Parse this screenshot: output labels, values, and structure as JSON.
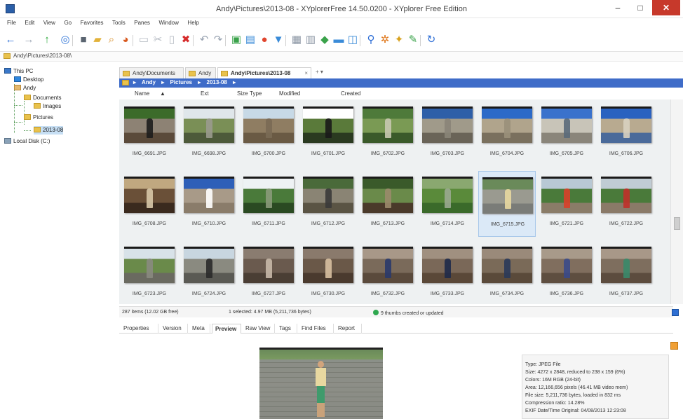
{
  "window": {
    "title": "Andy\\Pictures\\2013-08 - XYplorerFree 14.50.0200 - XYplorer Free Edition",
    "minimize": "–",
    "maximize": "□",
    "close": "✕"
  },
  "menu": [
    "File",
    "Edit",
    "View",
    "Go",
    "Favorites",
    "Tools",
    "Panes",
    "Window",
    "Help"
  ],
  "toolbar": [
    {
      "name": "back-icon",
      "glyph": "←",
      "color": "#2f6fd6"
    },
    {
      "name": "forward-icon",
      "glyph": "→",
      "color": "#9aa4b2"
    },
    {
      "name": "up-icon",
      "glyph": "↑",
      "color": "#2faa3c"
    },
    {
      "name": "target-icon",
      "glyph": "◎",
      "color": "#3578d8"
    },
    {
      "name": "drive-icon",
      "glyph": "■",
      "color": "#5a6470"
    },
    {
      "name": "folder-icon",
      "glyph": "▰",
      "color": "#e2b23a"
    },
    {
      "name": "find-icon",
      "glyph": "⌕",
      "color": "#d68a1f"
    },
    {
      "name": "clock-icon",
      "glyph": "◕",
      "color": "#d8591f"
    },
    {
      "name": "copy-icon",
      "glyph": "▭",
      "color": "#b7bcc4"
    },
    {
      "name": "cut-icon",
      "glyph": "✂",
      "color": "#b7bcc4"
    },
    {
      "name": "paste-icon",
      "glyph": "▯",
      "color": "#b7bcc4"
    },
    {
      "name": "delete-icon",
      "glyph": "✖",
      "color": "#d62b2b"
    },
    {
      "name": "undo-icon",
      "glyph": "↶",
      "color": "#9aa4b2"
    },
    {
      "name": "redo-icon",
      "glyph": "↷",
      "color": "#9aa4b2"
    },
    {
      "name": "phone-icon",
      "glyph": "▣",
      "color": "#3aa24a"
    },
    {
      "name": "image-icon",
      "glyph": "▤",
      "color": "#3a8bd8"
    },
    {
      "name": "color-icon",
      "glyph": "●",
      "color": "#e0452e"
    },
    {
      "name": "filter-icon",
      "glyph": "▼",
      "color": "#3a8bd8"
    },
    {
      "name": "grid-icon",
      "glyph": "▦",
      "color": "#8a95a3"
    },
    {
      "name": "thumbs-icon",
      "glyph": "▥",
      "color": "#8a95a3"
    },
    {
      "name": "view-icon",
      "glyph": "◆",
      "color": "#3aa24a"
    },
    {
      "name": "split-icon",
      "glyph": "▬",
      "color": "#3a8bd8"
    },
    {
      "name": "info-icon",
      "glyph": "◫",
      "color": "#3a8bd8"
    },
    {
      "name": "search-icon",
      "glyph": "⚲",
      "color": "#2f6fd6"
    },
    {
      "name": "gear-icon",
      "glyph": "✲",
      "color": "#e07a1f"
    },
    {
      "name": "tools-icon",
      "glyph": "✦",
      "color": "#d8a21f"
    },
    {
      "name": "brush-icon",
      "glyph": "✎",
      "color": "#3aa24a"
    },
    {
      "name": "refresh-icon",
      "glyph": "↻",
      "color": "#2f6fd6"
    }
  ],
  "address": "Andy\\Pictures\\2013-08\\",
  "tree": [
    {
      "label": "This PC",
      "icon": "pc",
      "level": 0
    },
    {
      "label": "Desktop",
      "icon": "desk",
      "level": 1
    },
    {
      "label": "Andy",
      "icon": "user",
      "level": 1
    },
    {
      "label": "Documents",
      "icon": "folder",
      "level": 2
    },
    {
      "label": "Images",
      "icon": "folder",
      "level": 3
    },
    {
      "label": "Pictures",
      "icon": "folder",
      "level": 2
    },
    {
      "label": "2013-08",
      "icon": "folder",
      "level": 3,
      "selected": true
    },
    {
      "label": "Local Disk (C:)",
      "icon": "disk",
      "level": 0
    }
  ],
  "tabs": [
    {
      "label": "Andy\\Documents",
      "active": false
    },
    {
      "label": "Andy",
      "active": false
    },
    {
      "label": "Andy\\Pictures\\2013-08",
      "active": true
    }
  ],
  "tab_extra": "+  ▾",
  "breadcrumb": [
    "▸",
    "Andy",
    "▸",
    "Pictures",
    "▸",
    "2013-08",
    "▸"
  ],
  "columns": [
    "Name",
    "▲",
    "Ext",
    "Size",
    "Type",
    "Modified",
    "Created"
  ],
  "thumbnails": [
    {
      "name": "IMG_6691.JPG",
      "top": "#3c6b2a",
      "mid": "#8d8274",
      "bottom": "#5a4a3a",
      "accent": "#1d1d1d"
    },
    {
      "name": "IMG_6698.JPG",
      "top": "#dfe6ea",
      "mid": "#7a8f56",
      "bottom": "#4d5a3a",
      "accent": "#9a9a8e"
    },
    {
      "name": "IMG_6700.JPG",
      "top": "#c7d9e6",
      "mid": "#8f7d62",
      "bottom": "#6a5a44",
      "accent": "#7a6a55"
    },
    {
      "name": "IMG_6701.JPG",
      "top": "#ffffff",
      "mid": "#5a7a3a",
      "bottom": "#2a3a20",
      "accent": "#1a1a1a"
    },
    {
      "name": "IMG_6702.JPG",
      "top": "#4e7a3a",
      "mid": "#7a9a54",
      "bottom": "#3a5a2a",
      "accent": "#c8c8b0"
    },
    {
      "name": "IMG_6703.JPG",
      "top": "#2e5fa8",
      "mid": "#a09a8a",
      "bottom": "#6a6458",
      "accent": "#8a8478"
    },
    {
      "name": "IMG_6704.JPG",
      "top": "#2c6ac8",
      "mid": "#b0a48c",
      "bottom": "#7a705e",
      "accent": "#9a907a"
    },
    {
      "name": "IMG_6705.JPG",
      "top": "#3a72cc",
      "mid": "#c8c4b8",
      "bottom": "#8a857a",
      "accent": "#5a6a7a"
    },
    {
      "name": "IMG_6706.JPG",
      "top": "#2a62c0",
      "mid": "#b8aa90",
      "bottom": "#4a6a9a",
      "accent": "#d8d0c0"
    },
    {
      "name": "IMG_6708.JPG",
      "top": "#c0a880",
      "mid": "#6a5038",
      "bottom": "#3a2a1e",
      "accent": "#d8c8a8"
    },
    {
      "name": "IMG_6710.JPG",
      "top": "#2e5fb8",
      "mid": "#a89a88",
      "bottom": "#8a7c6a",
      "accent": "#ffffff"
    },
    {
      "name": "IMG_6711.JPG",
      "top": "#eef2f4",
      "mid": "#4a7a3a",
      "bottom": "#2a4a22",
      "accent": "#8a9a7a"
    },
    {
      "name": "IMG_6712.JPG",
      "top": "#4a6a3a",
      "mid": "#8a8474",
      "bottom": "#5a5444",
      "accent": "#3a3a3a"
    },
    {
      "name": "IMG_6713.JPG",
      "top": "#3a5a2a",
      "mid": "#6a8a4a",
      "bottom": "#4a3a2a",
      "accent": "#9a8a6a"
    },
    {
      "name": "IMG_6714.JPG",
      "top": "#8aa870",
      "mid": "#5a8a3a",
      "bottom": "#3a6a2a",
      "accent": "#9aa890"
    },
    {
      "name": "IMG_6715.JPG",
      "top": "#6a8a5a",
      "mid": "#9a9a90",
      "bottom": "#7a7c78",
      "accent": "#e8d8a0"
    },
    {
      "name": "IMG_6721.JPG",
      "top": "#b8c8d4",
      "mid": "#4a7a3a",
      "bottom": "#8a7c68",
      "accent": "#d8402a"
    },
    {
      "name": "IMG_6722.JPG",
      "top": "#c0ccd4",
      "mid": "#4a7a3a",
      "bottom": "#8a7a68",
      "accent": "#c0302a"
    },
    {
      "name": "IMG_6723.JPG",
      "top": "#d8e2e8",
      "mid": "#6a8a4a",
      "bottom": "#6a6a60",
      "accent": "#8a8a80"
    },
    {
      "name": "IMG_6724.JPG",
      "top": "#c8d6e0",
      "mid": "#8a8a80",
      "bottom": "#5a5a54",
      "accent": "#2a2a2a"
    },
    {
      "name": "IMG_6727.JPG",
      "top": "#8a7c70",
      "mid": "#6a5a4e",
      "bottom": "#4a3e34",
      "accent": "#c8b8a8"
    },
    {
      "name": "IMG_6730.JPG",
      "top": "#8a7a6c",
      "mid": "#6a5848",
      "bottom": "#4a3a2e",
      "accent": "#d8c0a0"
    },
    {
      "name": "IMG_6732.JPG",
      "top": "#a89888",
      "mid": "#7a6a5a",
      "bottom": "#5a4a3c",
      "accent": "#2a3a6a"
    },
    {
      "name": "IMG_6733.JPG",
      "top": "#a09080",
      "mid": "#7a6858",
      "bottom": "#5a4838",
      "accent": "#1e2a4a"
    },
    {
      "name": "IMG_6734.JPG",
      "top": "#9a8a7a",
      "mid": "#7a6a58",
      "bottom": "#5a4a3a",
      "accent": "#2a3a5a"
    },
    {
      "name": "IMG_6736.JPG",
      "top": "#a89a8a",
      "mid": "#806e5e",
      "bottom": "#5e4e40",
      "accent": "#3a4a8a"
    },
    {
      "name": "IMG_6737.JPG",
      "top": "#a89888",
      "mid": "#7e6e5e",
      "bottom": "#5c4c3e",
      "accent": "#3a8a6a"
    }
  ],
  "selected_index": 15,
  "status": {
    "items": "287 items (12.02 GB free)",
    "selected": "1 selected: 4.97 MB (5,211,736 bytes)",
    "thumbs": "9 thumbs created or updated"
  },
  "info_tabs": [
    {
      "label": "Properties",
      "active": false
    },
    {
      "label": "Version",
      "active": false
    },
    {
      "label": "Meta",
      "active": false
    },
    {
      "label": "Preview",
      "active": true
    },
    {
      "label": "Raw View",
      "active": false
    },
    {
      "label": "Tags",
      "active": false
    },
    {
      "label": "Find Files",
      "active": false
    },
    {
      "label": "Report",
      "active": false
    }
  ],
  "preview_info": [
    "Type: JPEG File",
    "Size: 4272 x 2848, reduced to 238 x 159 (6%)",
    "Colors: 16M RGB (24-bit)",
    "Area: 12,166,656 pixels (46.41 MB video mem)",
    "File size: 5,211,736 bytes, loaded in 832 ms",
    "Compression ratio: 14.28%",
    "EXIF Date/Time Original: 04/08/2013 12:23:08"
  ]
}
